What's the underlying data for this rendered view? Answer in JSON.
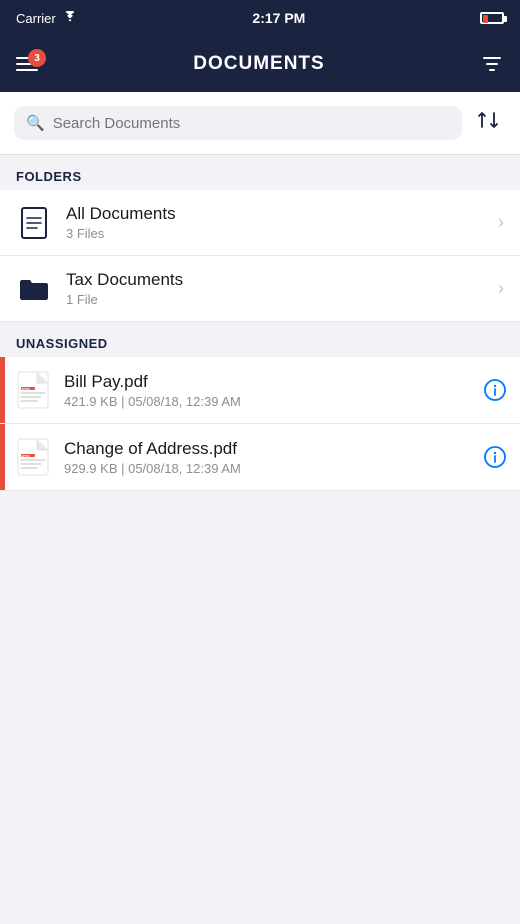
{
  "status_bar": {
    "carrier": "Carrier",
    "time": "2:17 PM",
    "wifi_signal": "wifi",
    "battery_low": true
  },
  "header": {
    "title": "DOCUMENTS",
    "badge_count": "3",
    "filter_icon": "filter-icon",
    "menu_icon": "menu-icon"
  },
  "search": {
    "placeholder": "Search Documents",
    "sort_icon": "sort-icon"
  },
  "sections": {
    "folders_label": "FOLDERS",
    "unassigned_label": "UNASSIGNED"
  },
  "folders": [
    {
      "title": "All Documents",
      "subtitle": "3 Files",
      "icon": "document-icon"
    },
    {
      "title": "Tax Documents",
      "subtitle": "1 File",
      "icon": "folder-icon"
    }
  ],
  "unassigned_files": [
    {
      "name": "Bill Pay.pdf",
      "details": "421.9 KB | 05/08/18, 12:39 AM",
      "type": "pdf"
    },
    {
      "name": "Change of Address.pdf",
      "details": "929.9 KB | 05/08/18, 12:39 AM",
      "type": "pdf"
    }
  ]
}
